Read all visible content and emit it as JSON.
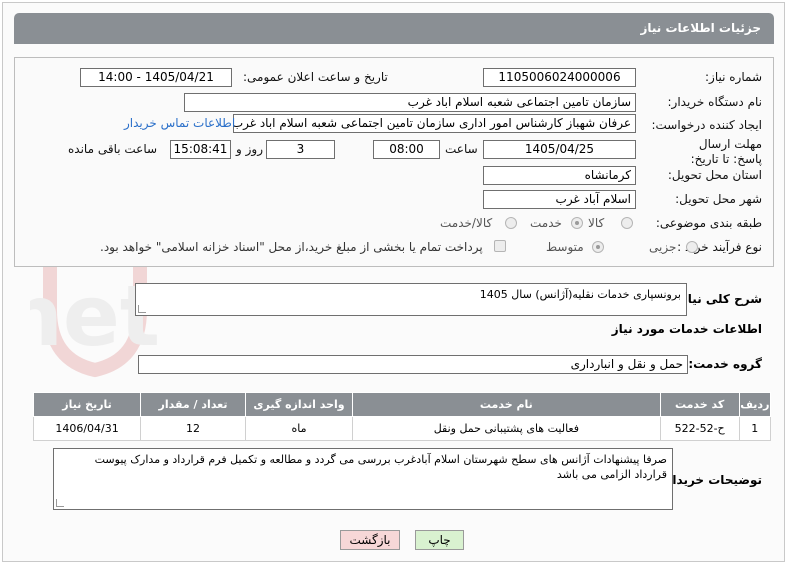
{
  "header": {
    "title": "جزئیات اطلاعات نیاز"
  },
  "form": {
    "need_number_label": "شماره نیاز:",
    "need_number": "1105006024000006",
    "announce_label": "تاریخ و ساعت اعلان عمومی:",
    "announce_value": "1405/04/21 - 14:00",
    "buyer_org_label": "نام دستگاه خریدار:",
    "buyer_org": "سازمان تامین اجتماعی شعبه اسلام اباد غرب",
    "creator_label": "ایجاد کننده درخواست:",
    "creator": "عرفان شهباز کارشناس امور اداری سازمان تامین اجتماعی شعبه اسلام اباد غرب",
    "contact_link": "اطلاعات تماس خریدار",
    "deadline_label": "مهلت ارسال پاسخ: تا تاریخ:",
    "deadline_date": "1405/04/25",
    "time_label": "ساعت",
    "deadline_time": "08:00",
    "days_value": "3",
    "days_label": "روز و",
    "remaining_time": "15:08:41",
    "remaining_label": "ساعت باقی مانده",
    "province_label": "استان محل تحویل:",
    "province": "کرمانشاه",
    "city_label": "شهر محل تحویل:",
    "city": "اسلام آباد غرب",
    "category_label": "طبقه بندی موضوعی:",
    "category_options": [
      "کالا",
      "خدمت",
      "کالا/خدمت"
    ],
    "category_selected": 1,
    "process_label": "نوع فرآیند خرید :",
    "process_options": [
      "جزیی",
      "متوسط"
    ],
    "process_selected": 1,
    "payment_note": "پرداخت تمام یا بخشی از مبلغ خرید،از محل \"اسناد خزانه اسلامی\" خواهد بود."
  },
  "summary": {
    "label": "شرح کلی نیاز:",
    "value": "برونسپاری خدمات نقلیه(آژانس) سال 1405"
  },
  "services": {
    "title": "اطلاعات خدمات مورد نیاز",
    "group_label": "گروه خدمت:",
    "group_value": "حمل و نقل و انبارداری",
    "columns": [
      "ردیف",
      "کد خدمت",
      "نام خدمت",
      "واحد اندازه گیری",
      "تعداد / مقدار",
      "تاریخ نیاز"
    ],
    "rows": [
      [
        "1",
        "ح-52-522",
        "فعالیت های پشتیبانی حمل ونقل",
        "ماه",
        "12",
        "1406/04/31"
      ]
    ]
  },
  "notes": {
    "label": "توضیحات خریدار:",
    "value": "صرفا پیشنهادات آژانس های سطح شهرستان اسلام آبادغرب بررسی می گردد و مطالعه و تکمیل فرم قرارداد و مدارک پیوست قرارداد الزامی می باشد"
  },
  "buttons": {
    "print": "چاپ",
    "back": "بازگشت"
  },
  "watermark": {
    "text": "AriaTender.net"
  },
  "colors": {
    "header_bg": "#8a8f94",
    "link": "#2a6fc9",
    "back_bg": "#f7d7d7",
    "print_bg": "#d9f2d0"
  }
}
